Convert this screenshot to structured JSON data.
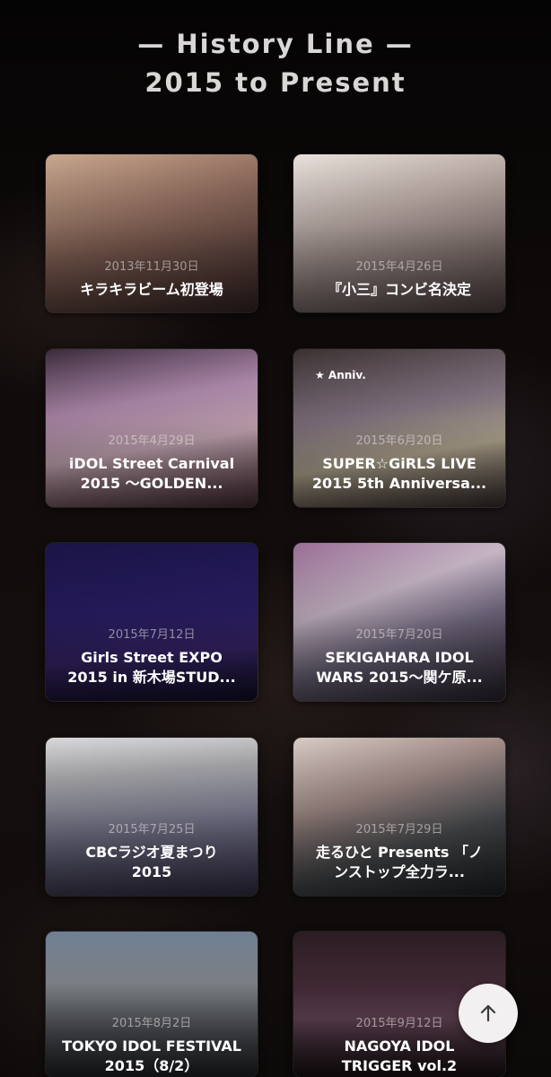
{
  "header": {
    "line1": "— History Line —",
    "line2": "2015 to Present"
  },
  "cards": [
    {
      "date": "2013年11月30日",
      "title": "キラキラビーム初登場"
    },
    {
      "date": "2015年4月26日",
      "title": "『小三』コンビ名決定"
    },
    {
      "date": "2015年4月29日",
      "title_line1": "iDOL Street Carnival",
      "title_line2": "2015 〜GOLDEN..."
    },
    {
      "date": "2015年6月20日",
      "badge": "★ Anniv.",
      "title_line1": "SUPER☆GiRLS LIVE",
      "title_line2": "2015 5th Anniversa..."
    },
    {
      "date": "2015年7月12日",
      "title_line1": "Girls Street EXPO",
      "title_line2": "2015 in 新木場STUD..."
    },
    {
      "date": "2015年7月20日",
      "title_line1": "SEKIGAHARA IDOL",
      "title_line2": "WARS 2015〜関ケ原..."
    },
    {
      "date": "2015年7月25日",
      "title_line1": "CBCラジオ夏まつり",
      "title_line2": "2015"
    },
    {
      "date": "2015年7月29日",
      "title_line1": "走るひと Presents 「ノ",
      "title_line2": "ンストップ全力ラ..."
    },
    {
      "date": "2015年8月2日",
      "title_line1": "TOKYO IDOL FESTIVAL",
      "title_line2": "2015（8/2）"
    },
    {
      "date": "2015年9月12日",
      "title_line1": "NAGOYA IDOL",
      "title_line2": "TRIGGER vol.2"
    }
  ],
  "fab": {
    "icon": "arrow-up-icon"
  }
}
